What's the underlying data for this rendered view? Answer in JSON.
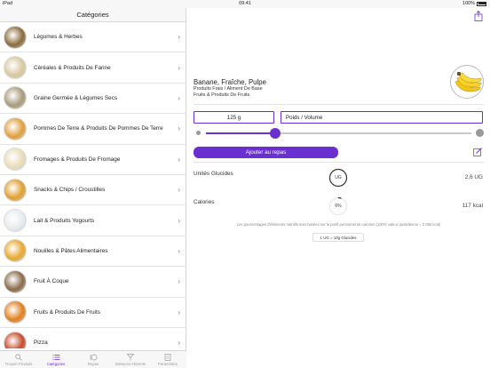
{
  "status": {
    "device": "iPad",
    "time": "09:41",
    "battery": "100%"
  },
  "sidebar": {
    "title": "Catégories",
    "items": [
      {
        "label": "Légumes & Herbes",
        "color": "#8a6a3a"
      },
      {
        "label": "Céréales & Produits De Farine",
        "color": "#d8c8a0"
      },
      {
        "label": "Graine Germée & Légumes Secs",
        "color": "#a89a7a"
      },
      {
        "label": "Pommes De Terre & Produits De Pommes De Terre",
        "color": "#e0a040"
      },
      {
        "label": "Fromages & Produits De Fromage",
        "color": "#e8dcb8"
      },
      {
        "label": "Snacks & Chips / Croustilles",
        "color": "#e0a030"
      },
      {
        "label": "Lait & Produits Yogourts",
        "color": "#e8ecef"
      },
      {
        "label": "Nouilles & Pâtes Alimentaires",
        "color": "#e8a830"
      },
      {
        "label": "Fruit À Coque",
        "color": "#8a6a4a"
      },
      {
        "label": "Fruits & Produits De Fruits",
        "color": "#e08020"
      },
      {
        "label": "Pizza",
        "color": "#c84a2a"
      }
    ]
  },
  "tabbar": {
    "tabs": [
      {
        "label": "Trouver Produits",
        "icon": "search-icon",
        "active": false
      },
      {
        "label": "Catégories",
        "icon": "list-icon",
        "active": true
      },
      {
        "label": "Repas",
        "icon": "meals-icon",
        "active": false
      },
      {
        "label": "Boissons Aliments",
        "icon": "drink-icon",
        "active": false
      },
      {
        "label": "Paramètres",
        "icon": "settings-icon",
        "active": false
      }
    ]
  },
  "detail": {
    "title": "Banane, Fraîche, Pulpe",
    "subtitle1": "Produits Frais / Aliment De Base",
    "subtitle2": "Fruits & Produits De Fruits",
    "quantity": "125 g",
    "unit": "Poids / Volume",
    "slider_fraction": 0.26,
    "add_button": "Ajouter au repas",
    "carb_label": "Unités Glucides",
    "carb_ring": "UG",
    "carb_value": "2,6 UG",
    "calorie_label": "Calories",
    "calorie_ring": "6%",
    "calorie_value": "117 kcal",
    "calorie_fraction": 0.06,
    "footnote": "Les pourcentages d'éléments nutritifs sont basées sur le profil personnel de calories (100% valeur quotidienne = 2 050 kcal)",
    "conversion": "1 UG = 10g Glucides"
  },
  "colors": {
    "accent": "#6b2fd0"
  }
}
